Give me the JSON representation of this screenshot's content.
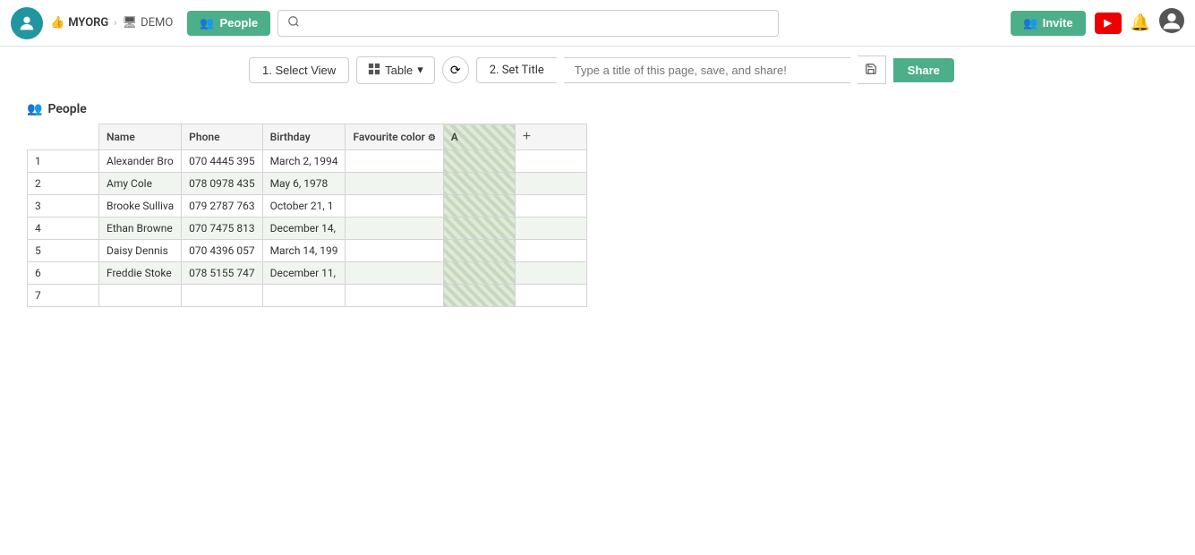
{
  "nav": {
    "logo_icon": "👤",
    "org_name": "MYORG",
    "demo_label": "DEMO",
    "people_button": "People",
    "search_placeholder": "",
    "invite_button": "Invite",
    "youtube_label": "▶"
  },
  "toolbar": {
    "step1_label": "1. Select View",
    "table_label": "Table",
    "step2_label": "2. Set Title",
    "title_placeholder": "Type a title of this page, save, and share!",
    "share_label": "Share"
  },
  "table": {
    "title": "People",
    "columns": [
      "Name",
      "Phone",
      "Birthday",
      "Favourite color",
      "A"
    ],
    "rows": [
      {
        "num": "1",
        "name": "Alexander Bro",
        "phone": "070 4445 395",
        "birthday": "March 2, 1994",
        "fav_color": "",
        "a": ""
      },
      {
        "num": "2",
        "name": "Amy Cole",
        "phone": "078 0978 435",
        "birthday": "May 6, 1978",
        "fav_color": "",
        "a": ""
      },
      {
        "num": "3",
        "name": "Brooke Sulliva",
        "phone": "079 2787 763",
        "birthday": "October 21, 1",
        "fav_color": "",
        "a": ""
      },
      {
        "num": "4",
        "name": "Ethan Browne",
        "phone": "070 7475 813",
        "birthday": "December 14,",
        "fav_color": "",
        "a": ""
      },
      {
        "num": "5",
        "name": "Daisy Dennis",
        "phone": "070 4396 057",
        "birthday": "March 14, 199",
        "fav_color": "",
        "a": ""
      },
      {
        "num": "6",
        "name": "Freddie Stoke",
        "phone": "078 5155 747",
        "birthday": "December 11,",
        "fav_color": "",
        "a": ""
      },
      {
        "num": "7",
        "name": "",
        "phone": "",
        "birthday": "",
        "fav_color": "",
        "a": ""
      }
    ]
  }
}
